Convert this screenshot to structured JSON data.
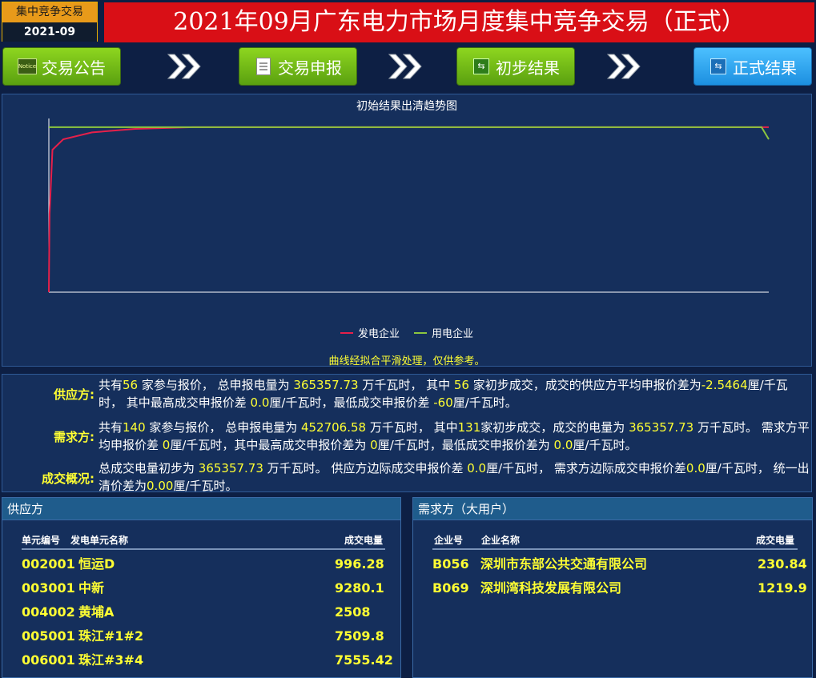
{
  "header": {
    "badge_top": "集中竞争交易",
    "badge_date": "2021-09",
    "title": "2021年09月广东电力市场月度集中竞争交易（正式）"
  },
  "steps": [
    {
      "label": "交易公告",
      "icon": "notice-icon",
      "active": false
    },
    {
      "label": "交易申报",
      "icon": "document-icon",
      "active": false
    },
    {
      "label": "初步结果",
      "icon": "network-icon",
      "active": false
    },
    {
      "label": "正式结果",
      "icon": "network-icon",
      "active": true
    }
  ],
  "chart_data": {
    "type": "line",
    "title": "初始结果出清趋势图",
    "xlabel": "",
    "ylabel": "",
    "grid": false,
    "legend_position": "bottom",
    "series": [
      {
        "name": "发电企业",
        "color": "#e6204a",
        "points": [
          [
            0,
            0
          ],
          [
            0.001,
            0.45
          ],
          [
            0.005,
            0.82
          ],
          [
            0.02,
            0.88
          ],
          [
            0.06,
            0.92
          ],
          [
            0.12,
            0.94
          ],
          [
            0.2,
            0.95
          ],
          [
            0.3,
            0.95
          ],
          [
            0.5,
            0.95
          ],
          [
            0.7,
            0.95
          ],
          [
            0.9,
            0.95
          ],
          [
            1.0,
            0.95
          ]
        ]
      },
      {
        "name": "用电企业",
        "color": "#8cc63f",
        "points": [
          [
            0,
            0.95
          ],
          [
            0.2,
            0.95
          ],
          [
            0.4,
            0.95
          ],
          [
            0.6,
            0.95
          ],
          [
            0.8,
            0.95
          ],
          [
            0.99,
            0.95
          ],
          [
            1.0,
            0.88
          ]
        ]
      }
    ],
    "note": "曲线经拟合平滑处理，仅供参考。"
  },
  "summary": {
    "supply": {
      "label": "供应方:",
      "parts": [
        {
          "t": "共有"
        },
        {
          "t": "56",
          "hl": true
        },
        {
          "t": " 家参与报价， 总申报电量为 "
        },
        {
          "t": "365357.73",
          "hl": true
        },
        {
          "t": " 万千瓦时， 其中 "
        },
        {
          "t": "56",
          "hl": true
        },
        {
          "t": " 家初步成交，成交的供应方平均申报价差为"
        },
        {
          "t": "-2.5464",
          "hl": true
        },
        {
          "t": "厘/千瓦时， 其中最高成交申报价差 "
        },
        {
          "t": "0.0",
          "hl": true
        },
        {
          "t": "厘/千瓦时，最低成交申报价差 "
        },
        {
          "t": "-60",
          "hl": true
        },
        {
          "t": "厘/千瓦时。"
        }
      ]
    },
    "demand": {
      "label": "需求方:",
      "parts": [
        {
          "t": "共有"
        },
        {
          "t": "140",
          "hl": true
        },
        {
          "t": " 家参与报价， 总申报电量为 "
        },
        {
          "t": "452706.58",
          "hl": true
        },
        {
          "t": " 万千瓦时， 其中"
        },
        {
          "t": "131",
          "hl": true
        },
        {
          "t": "家初步成交，成交的电量为 "
        },
        {
          "t": "365357.73",
          "hl": true
        },
        {
          "t": " 万千瓦时。 需求方平均申报价差 "
        },
        {
          "t": "0",
          "hl": true
        },
        {
          "t": "厘/千瓦时，其中最高成交申报价差为 "
        },
        {
          "t": "0",
          "hl": true
        },
        {
          "t": "厘/千瓦时，最低成交申报价差为 "
        },
        {
          "t": "0.0",
          "hl": true
        },
        {
          "t": "厘/千瓦时。"
        }
      ]
    },
    "overview": {
      "label": "成交概况:",
      "parts": [
        {
          "t": "总成交电量初步为 "
        },
        {
          "t": "365357.73",
          "hl": true
        },
        {
          "t": " 万千瓦时。 供应方边际成交申报价差 "
        },
        {
          "t": "0.0",
          "hl": true
        },
        {
          "t": "厘/千瓦时， 需求方边际成交申报价差"
        },
        {
          "t": "0.0",
          "hl": true
        },
        {
          "t": "厘/千瓦时， 统一出清价差为"
        },
        {
          "t": "0.00",
          "hl": true
        },
        {
          "t": "厘/千瓦时。"
        }
      ]
    }
  },
  "supply_table": {
    "title": "供应方",
    "headers": [
      "单元编号",
      "发电单元名称",
      "成交电量"
    ],
    "rows": [
      [
        "002001",
        "恒运D",
        "996.28"
      ],
      [
        "003001",
        "中新",
        "9280.1"
      ],
      [
        "004002",
        "黄埔A",
        "2508"
      ],
      [
        "005001",
        "珠江#1#2",
        "7509.8"
      ],
      [
        "006001",
        "珠江#3#4",
        "7555.42"
      ]
    ]
  },
  "demand_table": {
    "title": "需求方（大用户）",
    "headers": [
      "企业号",
      "企业名称",
      "成交电量"
    ],
    "rows": [
      [
        "B056",
        "深圳市东部公共交通有限公司",
        "230.84"
      ],
      [
        "B069",
        "深圳湾科技发展有限公司",
        "1219.9"
      ]
    ]
  }
}
